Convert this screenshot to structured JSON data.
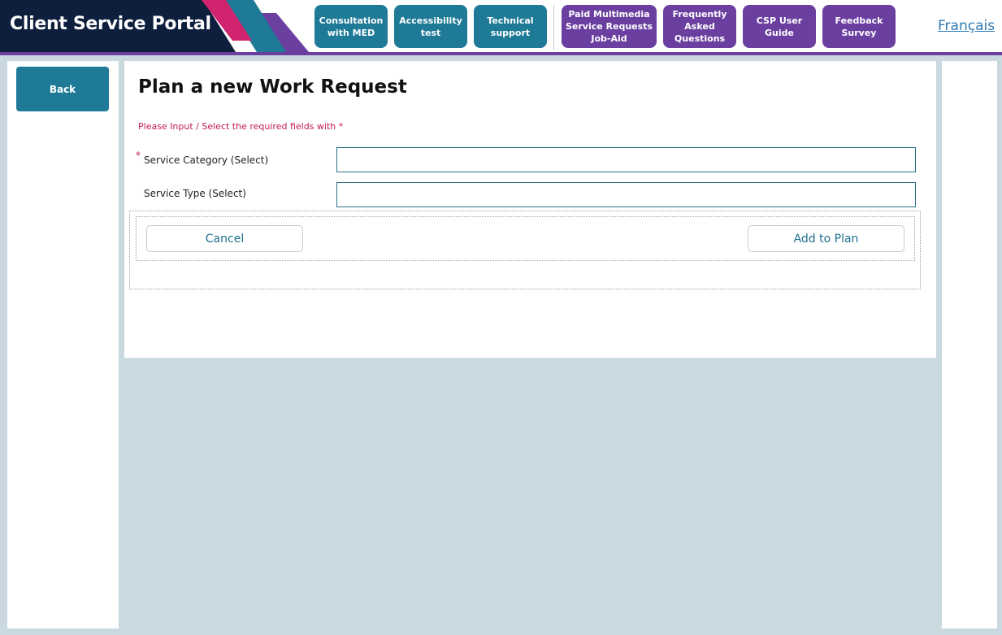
{
  "brand": {
    "title": "Client Service Portal"
  },
  "nav": {
    "consultation": "Consultation\nwith MED",
    "accessibility": "Accessibility\ntest",
    "technical": "Technical\nsupport",
    "paid_multimedia": "Paid Multimedia\nService Requests\nJob-Aid",
    "faq": "Frequently\nAsked\nQuestions",
    "user_guide": "CSP User\nGuide",
    "feedback": "Feedback\nSurvey",
    "language": "Français"
  },
  "sidebar": {
    "back_label": "Back"
  },
  "form": {
    "title": "Plan a new Work Request",
    "required_note": "Please Input / Select the required fields with *",
    "required_marker": "*",
    "service_category_label": "Service Category (Select)",
    "service_category_value": "",
    "service_type_label": "Service Type (Select)",
    "service_type_value": "",
    "cancel_label": "Cancel",
    "add_label": "Add to Plan"
  },
  "colors": {
    "teal": "#1e7a96",
    "purple": "#6b3fa0",
    "navy": "#0d1f3c",
    "pink": "#d0246e",
    "required": "#c2185b"
  }
}
